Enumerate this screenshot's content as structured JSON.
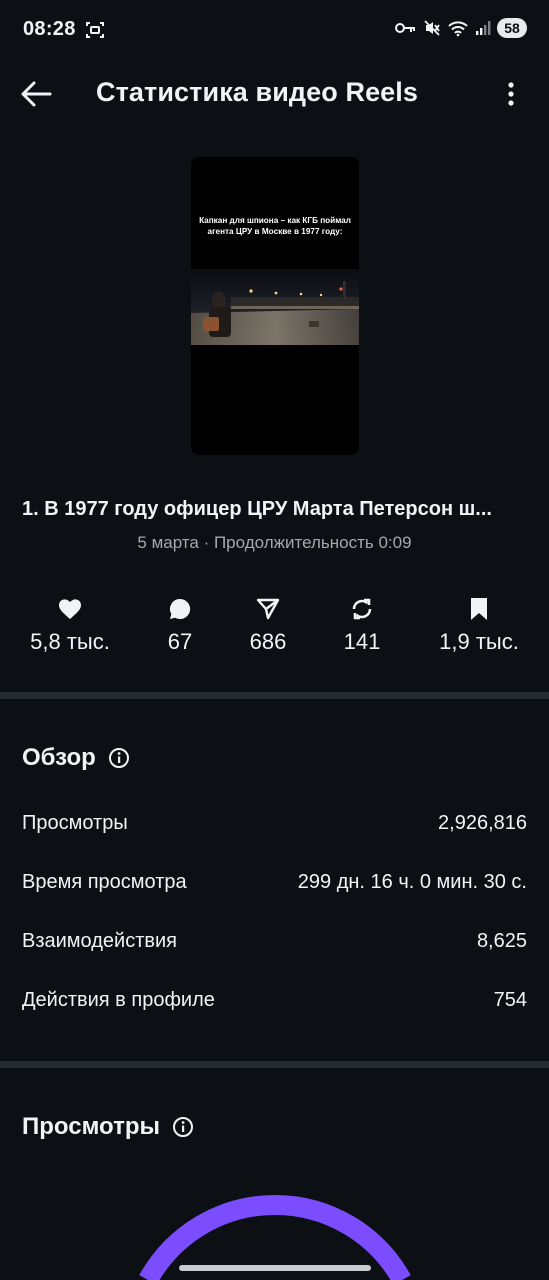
{
  "status_bar": {
    "time": "08:28",
    "battery": "58"
  },
  "header": {
    "title": "Статистика видео Reels"
  },
  "video": {
    "thumbnail_caption": "Капкан для шпиона – как КГБ поймал агента ЦРУ в Москве в 1977 году:",
    "title": "1. В 1977 году офицер ЦРУ Марта Петерсон ш...",
    "meta": "5 марта · Продолжительность 0:09"
  },
  "metrics": [
    {
      "icon": "heart-icon",
      "value": "5,8 тыс."
    },
    {
      "icon": "comment-icon",
      "value": "67"
    },
    {
      "icon": "share-icon",
      "value": "686"
    },
    {
      "icon": "repost-icon",
      "value": "141"
    },
    {
      "icon": "bookmark-icon",
      "value": "1,9 тыс."
    }
  ],
  "overview": {
    "title": "Обзор",
    "rows": [
      {
        "label": "Просмотры",
        "value": "2,926,816"
      },
      {
        "label": "Время просмотра",
        "value": "299 дн. 16 ч. 0 мин. 30 с."
      },
      {
        "label": "Взаимодействия",
        "value": "8,625"
      },
      {
        "label": "Действия в профиле",
        "value": "754"
      }
    ]
  },
  "views_section": {
    "title": "Просмотры"
  },
  "colors": {
    "background": "#0c1015",
    "divider": "#262b31",
    "gauge_accent": "#7b4dff",
    "muted_text": "#a4a8ae"
  }
}
